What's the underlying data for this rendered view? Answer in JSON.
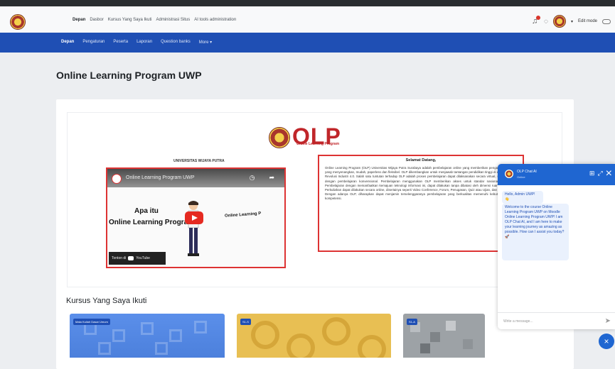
{
  "topbar": {
    "nav": [
      "Depan",
      "Dasbor",
      "Kursus Yang Saya Ikuti",
      "Administrasi Situs",
      "AI tools administration"
    ],
    "edit_mode": "Edit mode"
  },
  "secnav": {
    "items": [
      "Depan",
      "Pengaturan",
      "Peserta",
      "Laporan",
      "Question banks",
      "More ▾"
    ]
  },
  "page": {
    "title": "Online Learning Program UWP"
  },
  "banner": {
    "logo_text": "OLP",
    "logo_sub": "Online Learning Program",
    "university": "UNIVERSITAS WIJAYA PUTRA"
  },
  "video": {
    "title": "Online Learning Program UWP",
    "q_line1": "Apa itu",
    "q_line2": "Online Learning Program ?",
    "right_text": "Online Learning P",
    "watch": "Tonton di",
    "yt": "YouTube"
  },
  "welcome": {
    "title": "Selamat Datang,",
    "body": "Online Learning Program (OLP) Universitas Wijaya Putra Surabaya adalah pembelajaran online yang memberikan pengalaman belajar yang menyenangkan, mudah, paperless dan fleksibel. OLP dikembangkan untuk menjawab tantangan pendidikan tinggi di era digital dan Revolusi Industri 4.0. Salah satu tuntutan terhadap OLP adalah proses pembelajaran dapat dilaksanakan secara virtual, sama baiknya dengan pembelajaran konvensional. Pembelajaran menggunakan OLP memberikan akses untuk standar nasional pendidikan. Pembelajaran dengan memanfaatkan kemajuan teknologi informasi ini, dapat dilakukan tanpa dibatasi oleh dimensi ruang dan waktu. Perkuliahan dapat dilakukan secara online, disertainya seperti Video Conference, Forum, Penugasan, Quiz atau Ujian, dan Akses materi. Dengan adanya OLP, diharapkan dapat menjamin terselenggaranya pembelajaran yang berkualitas memenuhi kebutuhan standar kompetensi."
  },
  "courses": {
    "title": "Kursus Yang Saya Ikuti",
    "items": [
      {
        "badge": "Mata Kuliah Dasar Umum",
        "color": "#5b8fea"
      },
      {
        "badge": "S1-S",
        "color": "#e8bf53"
      },
      {
        "badge": "S1-A",
        "color": "#9da2a6"
      }
    ]
  },
  "chat": {
    "name": "OLP Chat AI",
    "status": "Online",
    "msg1": "Hello, Admin UWP! 👋",
    "msg2": "Welcome to the course Online Learning Program UWP on Moodle Online Learning Program UWP! I am OLP Chat AI, and I am here to make your learning journey as amazing as possible. How can I assist you today? 🚀",
    "placeholder": "Write a message..."
  },
  "colors": {
    "primary": "#1f4fb4",
    "chat_blue": "#1f66d1",
    "brand_red": "#c0262a"
  }
}
